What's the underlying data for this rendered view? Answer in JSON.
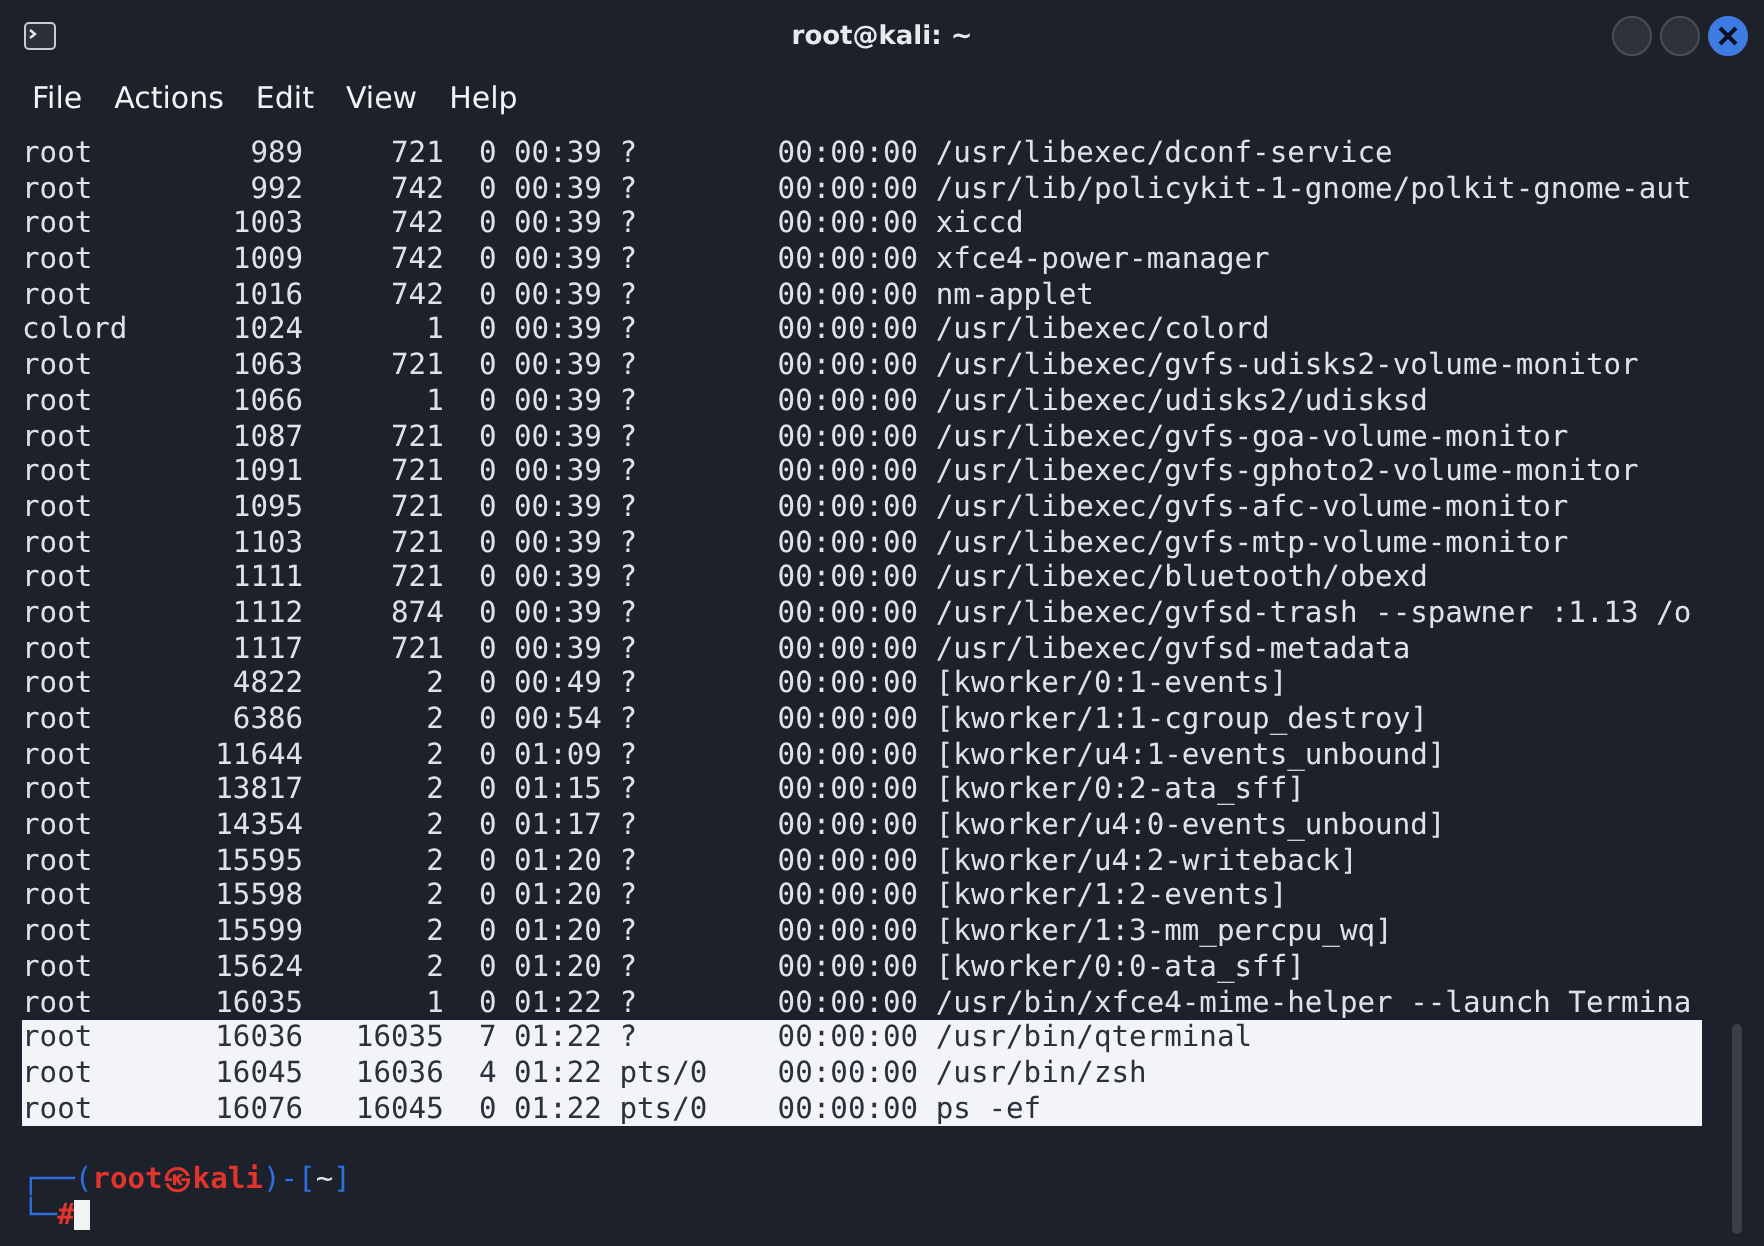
{
  "window": {
    "title": "root@kali: ~"
  },
  "menu": [
    {
      "label": "File"
    },
    {
      "label": "Actions"
    },
    {
      "label": "Edit"
    },
    {
      "label": "View"
    },
    {
      "label": "Help"
    }
  ],
  "output": [
    {
      "text": "root         989     721  0 00:39 ?        00:00:00 /usr/libexec/dconf-service",
      "selected": false
    },
    {
      "text": "root         992     742  0 00:39 ?        00:00:00 /usr/lib/policykit-1-gnome/polkit-gnome-aut",
      "selected": false
    },
    {
      "text": "root        1003     742  0 00:39 ?        00:00:00 xiccd",
      "selected": false
    },
    {
      "text": "root        1009     742  0 00:39 ?        00:00:00 xfce4-power-manager",
      "selected": false
    },
    {
      "text": "root        1016     742  0 00:39 ?        00:00:00 nm-applet",
      "selected": false
    },
    {
      "text": "colord      1024       1  0 00:39 ?        00:00:00 /usr/libexec/colord",
      "selected": false
    },
    {
      "text": "root        1063     721  0 00:39 ?        00:00:00 /usr/libexec/gvfs-udisks2-volume-monitor",
      "selected": false
    },
    {
      "text": "root        1066       1  0 00:39 ?        00:00:00 /usr/libexec/udisks2/udisksd",
      "selected": false
    },
    {
      "text": "root        1087     721  0 00:39 ?        00:00:00 /usr/libexec/gvfs-goa-volume-monitor",
      "selected": false
    },
    {
      "text": "root        1091     721  0 00:39 ?        00:00:00 /usr/libexec/gvfs-gphoto2-volume-monitor",
      "selected": false
    },
    {
      "text": "root        1095     721  0 00:39 ?        00:00:00 /usr/libexec/gvfs-afc-volume-monitor",
      "selected": false
    },
    {
      "text": "root        1103     721  0 00:39 ?        00:00:00 /usr/libexec/gvfs-mtp-volume-monitor",
      "selected": false
    },
    {
      "text": "root        1111     721  0 00:39 ?        00:00:00 /usr/libexec/bluetooth/obexd",
      "selected": false
    },
    {
      "text": "root        1112     874  0 00:39 ?        00:00:00 /usr/libexec/gvfsd-trash --spawner :1.13 /o",
      "selected": false
    },
    {
      "text": "root        1117     721  0 00:39 ?        00:00:00 /usr/libexec/gvfsd-metadata",
      "selected": false
    },
    {
      "text": "root        4822       2  0 00:49 ?        00:00:00 [kworker/0:1-events]",
      "selected": false
    },
    {
      "text": "root        6386       2  0 00:54 ?        00:00:00 [kworker/1:1-cgroup_destroy]",
      "selected": false
    },
    {
      "text": "root       11644       2  0 01:09 ?        00:00:00 [kworker/u4:1-events_unbound]",
      "selected": false
    },
    {
      "text": "root       13817       2  0 01:15 ?        00:00:00 [kworker/0:2-ata_sff]",
      "selected": false
    },
    {
      "text": "root       14354       2  0 01:17 ?        00:00:00 [kworker/u4:0-events_unbound]",
      "selected": false
    },
    {
      "text": "root       15595       2  0 01:20 ?        00:00:00 [kworker/u4:2-writeback]",
      "selected": false
    },
    {
      "text": "root       15598       2  0 01:20 ?        00:00:00 [kworker/1:2-events]",
      "selected": false
    },
    {
      "text": "root       15599       2  0 01:20 ?        00:00:00 [kworker/1:3-mm_percpu_wq]",
      "selected": false
    },
    {
      "text": "root       15624       2  0 01:20 ?        00:00:00 [kworker/0:0-ata_sff]",
      "selected": false
    },
    {
      "text": "root       16035       1  0 01:22 ?        00:00:00 /usr/bin/xfce4-mime-helper --launch Termina",
      "selected": false
    },
    {
      "text": "root       16036   16035  7 01:22 ?        00:00:00 /usr/bin/qterminal",
      "selected": true
    },
    {
      "text": "root       16045   16036  4 01:22 pts/0    00:00:00 /usr/bin/zsh",
      "selected": true
    },
    {
      "text": "root       16076   16045  0 01:22 pts/0    00:00:00 ps -ef",
      "selected": true
    }
  ],
  "prompt": [
    [
      {
        "text": "┌──(",
        "kind": "frame"
      },
      {
        "text": "root㉿kali",
        "kind": "user"
      },
      {
        "text": ")-[",
        "kind": "frame"
      },
      {
        "text": "~",
        "kind": "path"
      },
      {
        "text": "]",
        "kind": "frame"
      }
    ],
    [
      {
        "text": "└─",
        "kind": "frame"
      },
      {
        "text": "#",
        "kind": "user"
      }
    ]
  ]
}
